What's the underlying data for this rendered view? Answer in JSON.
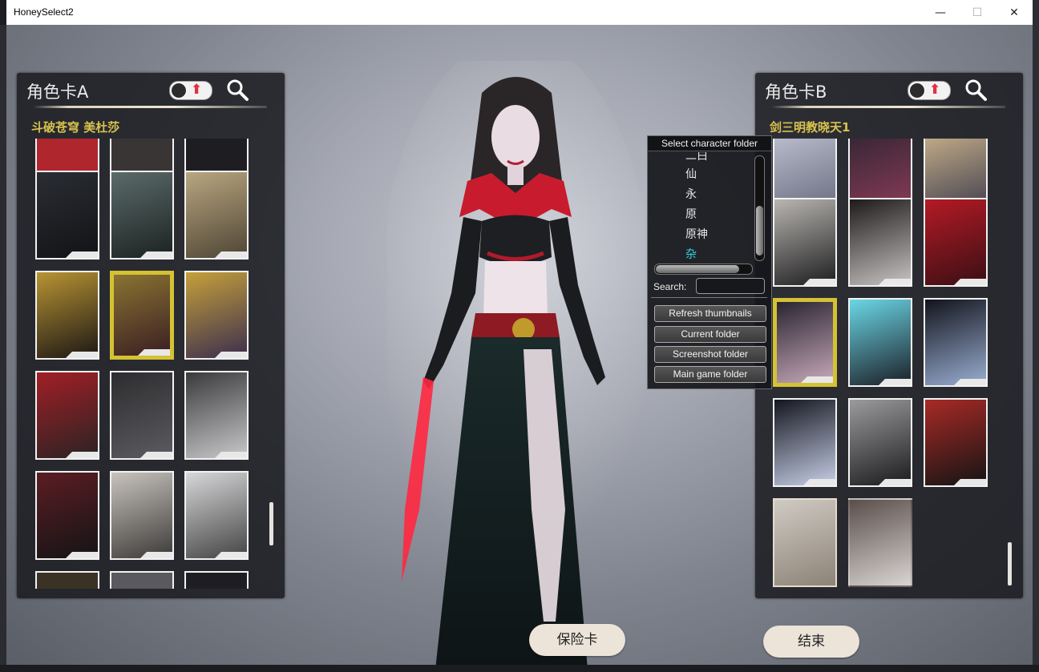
{
  "window": {
    "title": "HoneySelect2",
    "minimize": "—",
    "maximize": "☐",
    "close": "✕"
  },
  "panel_a": {
    "title": "角色卡A",
    "selected_name": "斗破苍穹 美杜莎"
  },
  "panel_b": {
    "title": "角色卡B",
    "selected_name": "剑三明教晓天1"
  },
  "folder_dialog": {
    "title": "Select character folder",
    "items": [
      "二白",
      "仙",
      "永",
      "原",
      "原神",
      "杂"
    ],
    "active_item": "杂",
    "search_label": "Search:",
    "search_value": "",
    "buttons": [
      "Refresh thumbnails",
      "Current folder",
      "Screenshot folder",
      "Main game folder"
    ]
  },
  "bottom": {
    "save_label": "保险卡",
    "end_label": "结束"
  },
  "colors": {
    "accent_gold": "#d4c233",
    "active_folder": "#34d3e0",
    "button_bg": "#ece3d9"
  },
  "icons": {
    "search": "magnifier-icon",
    "toggle": "upload-toggle-icon"
  }
}
